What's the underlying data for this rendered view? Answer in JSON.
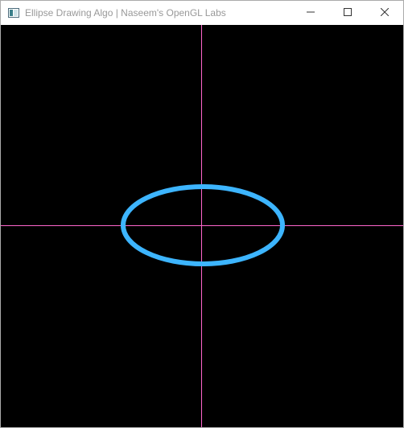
{
  "window": {
    "title": "Ellipse Drawing Algo | Naseem's OpenGL Labs",
    "icon": "opengl-app-icon"
  },
  "caption_buttons": {
    "minimize_icon": "minimize-icon",
    "maximize_icon": "maximize-icon",
    "close_icon": "close-icon"
  },
  "scene": {
    "background_color": "#000000",
    "axis_color": "#ff66cc",
    "ellipse_color": "#3db5ff"
  }
}
